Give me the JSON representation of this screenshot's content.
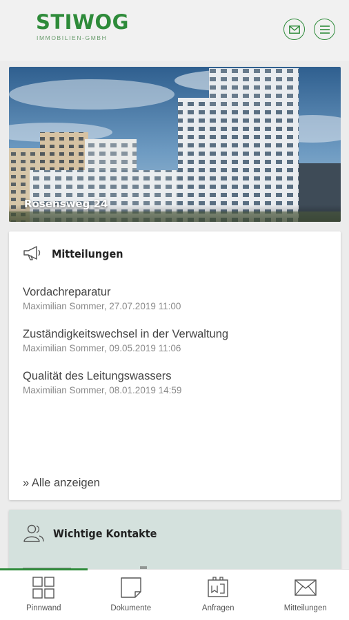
{
  "header": {
    "logo_main": "STIWOG",
    "logo_sub": "IMMOBILIEN-GMBH",
    "mail_icon": "mail-icon",
    "menu_icon": "menu-icon"
  },
  "hero": {
    "title": "Rosensweg 24"
  },
  "news": {
    "heading": "Mitteilungen",
    "items": [
      {
        "title": "Vordachreparatur",
        "meta": "Maximilian Sommer, 27.07.2019 11:00"
      },
      {
        "title": "Zuständigkeitswechsel in der Verwaltung",
        "meta": "Maximilian Sommer, 09.05.2019 11:06"
      },
      {
        "title": "Qualität des Leitungswassers",
        "meta": "Maximilian Sommer, 08.01.2019 14:59"
      }
    ],
    "show_all": "» Alle anzeigen"
  },
  "contacts": {
    "heading": "Wichtige Kontakte"
  },
  "tabs": [
    {
      "label": "Pinnwand",
      "icon": "grid-icon"
    },
    {
      "label": "Dokumente",
      "icon": "document-icon"
    },
    {
      "label": "Anfragen",
      "icon": "clipboard-icon"
    },
    {
      "label": "Mitteilungen",
      "icon": "envelope-icon"
    }
  ],
  "colors": {
    "brand_green": "#2e8b3a",
    "contacts_bg": "#d4e1dd"
  }
}
